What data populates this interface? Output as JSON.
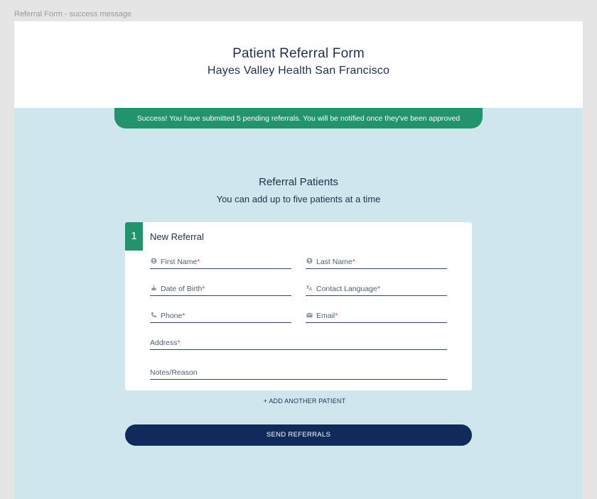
{
  "frame_label": "Referral Form - success message",
  "header": {
    "title": "Patient Referral Form",
    "subtitle": "Hayes Valley Health San Francisco"
  },
  "banner": {
    "message": "Success! You have submitted 5 pending referrals. You will be notified once they've been approved"
  },
  "section": {
    "title": "Referral Patients",
    "subtitle": "You can add up to five patients at a time"
  },
  "card": {
    "step_number": "1",
    "title": "New Referral",
    "required_mark": "*",
    "fields": {
      "first_name": {
        "label": "First Name",
        "icon": "person-icon"
      },
      "last_name": {
        "label": "Last Name",
        "icon": "person-icon"
      },
      "dob": {
        "label": "Date of Birth",
        "icon": "cake-icon"
      },
      "language": {
        "label": "Contact Language",
        "icon": "translate-icon"
      },
      "phone": {
        "label": "Phone",
        "icon": "phone-icon"
      },
      "email": {
        "label": "Email",
        "icon": "envelope-icon"
      },
      "address": {
        "label": "Address"
      },
      "notes": {
        "label": "Notes/Reason"
      }
    }
  },
  "actions": {
    "add_patient": "+ ADD ANOTHER PATIENT",
    "send": "SEND REFERRALS"
  },
  "colors": {
    "accent_green": "#21946e",
    "navy": "#0e2b5c",
    "panel_bg": "#cfe6ec",
    "required_red": "#e0474c"
  }
}
